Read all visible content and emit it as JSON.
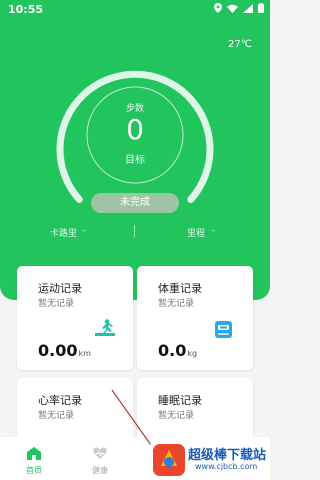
{
  "status_bar": {
    "time": "10:55"
  },
  "weather": {
    "temperature": "27℃"
  },
  "steps": {
    "label": "步数",
    "value": "0",
    "target_label": "目标",
    "progress_fraction": 0
  },
  "goal_status_button": "未完成",
  "stats": {
    "calories_label": "卡路里",
    "calories_value": "-",
    "distance_label": "里程",
    "distance_value": "-"
  },
  "cards": {
    "exercise": {
      "title": "运动记录",
      "subtitle": "暂无记录",
      "value": "0.00",
      "unit": "km",
      "icon": "running-icon"
    },
    "weight": {
      "title": "体重记录",
      "subtitle": "暂无记录",
      "value": "0.0",
      "unit": "kg",
      "icon": "scale-icon"
    },
    "heart": {
      "title": "心率记录",
      "subtitle": "暂无记录"
    },
    "sleep": {
      "title": "睡眠记录",
      "subtitle": "暂无记录"
    }
  },
  "tabs": [
    {
      "label": "首页",
      "icon": "home-icon",
      "active": true
    },
    {
      "label": "健康",
      "icon": "heart-icon",
      "active": false
    }
  ],
  "watermark": {
    "title": "超级棒下载站",
    "url": "www.cjbcb.com"
  },
  "colors": {
    "primary": "#22c45e",
    "button_gray": "#9fc4a5",
    "accent_teal": "#1fbfb0",
    "accent_blue": "#2aa7e8",
    "annotation_red": "#b03a3a"
  }
}
